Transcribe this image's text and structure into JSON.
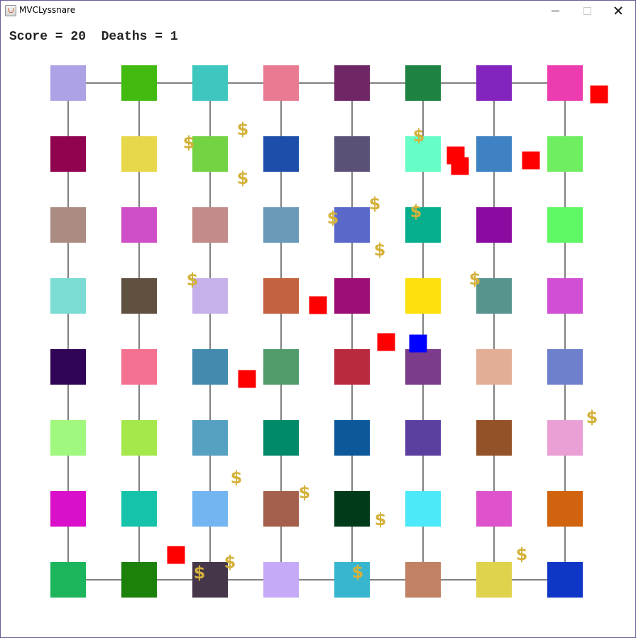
{
  "window": {
    "title": "MVCLyssnare",
    "icon": "java-cup-icon",
    "controls": [
      "minimize-icon",
      "maximize-icon",
      "close-icon"
    ]
  },
  "hud": {
    "text": "Score = 20  Deaths = 1",
    "score": 20,
    "deaths": 1
  },
  "board": {
    "rows": 8,
    "cols": 8,
    "tile_colors": [
      [
        "#aea2e6",
        "#42ba10",
        "#3dc7bf",
        "#e87a92",
        "#6f2665",
        "#1d8242",
        "#8224bd",
        "#ec3caf"
      ],
      [
        "#90044f",
        "#e6d84a",
        "#74d342",
        "#1d4eaa",
        "#5b5076",
        "#66fec6",
        "#3f82c3",
        "#70ee62"
      ],
      [
        "#ab8c82",
        "#ce4fc8",
        "#c38c8a",
        "#6b9ab9",
        "#5a68ca",
        "#05af8e",
        "#8b0ba1",
        "#60f764"
      ],
      [
        "#7bdcd4",
        "#5f5040",
        "#c7b1ea",
        "#c36240",
        "#9e0f75",
        "#fde00e",
        "#57948e",
        "#d14fd4"
      ],
      [
        "#300456",
        "#f37090",
        "#438aaf",
        "#529b6a",
        "#b92a3f",
        "#7b3c8b",
        "#e3ae96",
        "#6e7fcb"
      ],
      [
        "#a0f87e",
        "#a4e84b",
        "#56a0c2",
        "#008a69",
        "#0c589b",
        "#5c40a0",
        "#945228",
        "#eaa0d5"
      ],
      [
        "#d90fca",
        "#14c3a9",
        "#72b5f0",
        "#a4604c",
        "#003a18",
        "#4ce9fb",
        "#de53cb",
        "#d1620e"
      ],
      [
        "#1cb55b",
        "#1b810a",
        "#46364a",
        "#c5aaf8",
        "#38b6cf",
        "#c08164",
        "#dfd34e",
        "#0f36c6"
      ]
    ],
    "coin_symbol": "$",
    "colors": {
      "coin": "#d4b13a",
      "enemy": "#ff0000",
      "player": "#0000ff",
      "edge": "#000000"
    },
    "coins": [
      {
        "x": 1.7,
        "y": 0.84
      },
      {
        "x": 2.46,
        "y": 0.65
      },
      {
        "x": 4.94,
        "y": 0.74
      },
      {
        "x": 2.46,
        "y": 1.34
      },
      {
        "x": 4.32,
        "y": 1.7
      },
      {
        "x": 3.73,
        "y": 1.9
      },
      {
        "x": 4.9,
        "y": 1.81
      },
      {
        "x": 4.39,
        "y": 2.35
      },
      {
        "x": 1.75,
        "y": 2.77
      },
      {
        "x": 5.73,
        "y": 2.76
      },
      {
        "x": 7.38,
        "y": 4.71
      },
      {
        "x": 2.37,
        "y": 5.56
      },
      {
        "x": 3.33,
        "y": 5.77
      },
      {
        "x": 4.4,
        "y": 6.15
      },
      {
        "x": 6.39,
        "y": 6.64
      },
      {
        "x": 2.28,
        "y": 6.75
      },
      {
        "x": 1.85,
        "y": 6.9
      },
      {
        "x": 4.08,
        "y": 6.89
      }
    ],
    "enemies": [
      {
        "x": 7.48,
        "y": 0.16
      },
      {
        "x": 5.52,
        "y": 1.17
      },
      {
        "x": 6.52,
        "y": 1.09
      },
      {
        "x": 3.52,
        "y": 3.13
      },
      {
        "x": 4.48,
        "y": 3.65
      },
      {
        "x": 2.52,
        "y": 4.17
      },
      {
        "x": 1.52,
        "y": 6.65
      },
      {
        "x": 5.46,
        "y": 1.02
      }
    ],
    "player": {
      "x": 4.93,
      "y": 3.67
    }
  }
}
